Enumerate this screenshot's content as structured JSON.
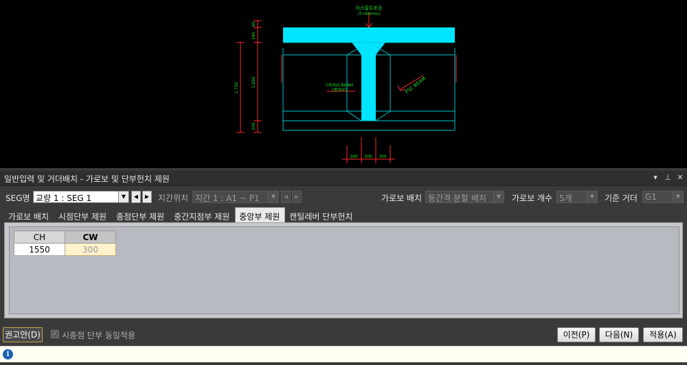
{
  "drawing": {
    "top_label": "아스팔트포장",
    "top_sublabel": "(T=80mm)",
    "dim_left_total": "1,750",
    "dim_left_mid": "1,890",
    "dim_left_top": "80",
    "dim_left_top2": "240",
    "dim_left_bottom": "200",
    "cross_beam_label": "CROSS BEAM",
    "cross_beam_sub": "(중앙부)",
    "psc_beam_label": "PSC BEAM",
    "dims_bottom": [
      "300",
      "300",
      "300"
    ],
    "colors": {
      "deck": "#00e5ff",
      "line": "#00c8d0",
      "dim": "#ff2a2a",
      "text": "#22dd22"
    }
  },
  "panel": {
    "title": "일반입력 및 거더배치 - 가로보 및 단부헌치 제원",
    "ctrl_icons": [
      "dropdown-icon",
      "pin-icon",
      "close-icon"
    ]
  },
  "toolbar": {
    "seg_label": "SEG명",
    "seg_value": "교량 1 : SEG 1",
    "span_label": "지간위치",
    "span_value": "지간 1 : A1 ~ P1",
    "beam_layout_label": "가로보 배치",
    "beam_layout_value": "등간격 분할 배치",
    "beam_count_label": "가로보 개수",
    "beam_count_value": "5개",
    "girder_label": "기준 거더",
    "girder_value": "G1"
  },
  "tabs": [
    {
      "label": "가로보 배치",
      "active": false
    },
    {
      "label": "시점단부 제원",
      "active": false
    },
    {
      "label": "종점단부 제원",
      "active": false
    },
    {
      "label": "중간지점부 제원",
      "active": false
    },
    {
      "label": "중앙부 제원",
      "active": true
    },
    {
      "label": "캔틸레버 단부헌치",
      "active": false
    }
  ],
  "grid": {
    "headers": [
      "CH",
      "CW"
    ],
    "rows": [
      [
        "1550",
        "300"
      ]
    ]
  },
  "bottom": {
    "recommend_label": "권고안(D)",
    "same_apply_label": "시종점 단부 동일적용",
    "prev_label": "이전(P)",
    "next_label": "다음(N)",
    "apply_label": "적용(A)"
  },
  "status": {
    "icon": "info-icon",
    "text": ""
  }
}
